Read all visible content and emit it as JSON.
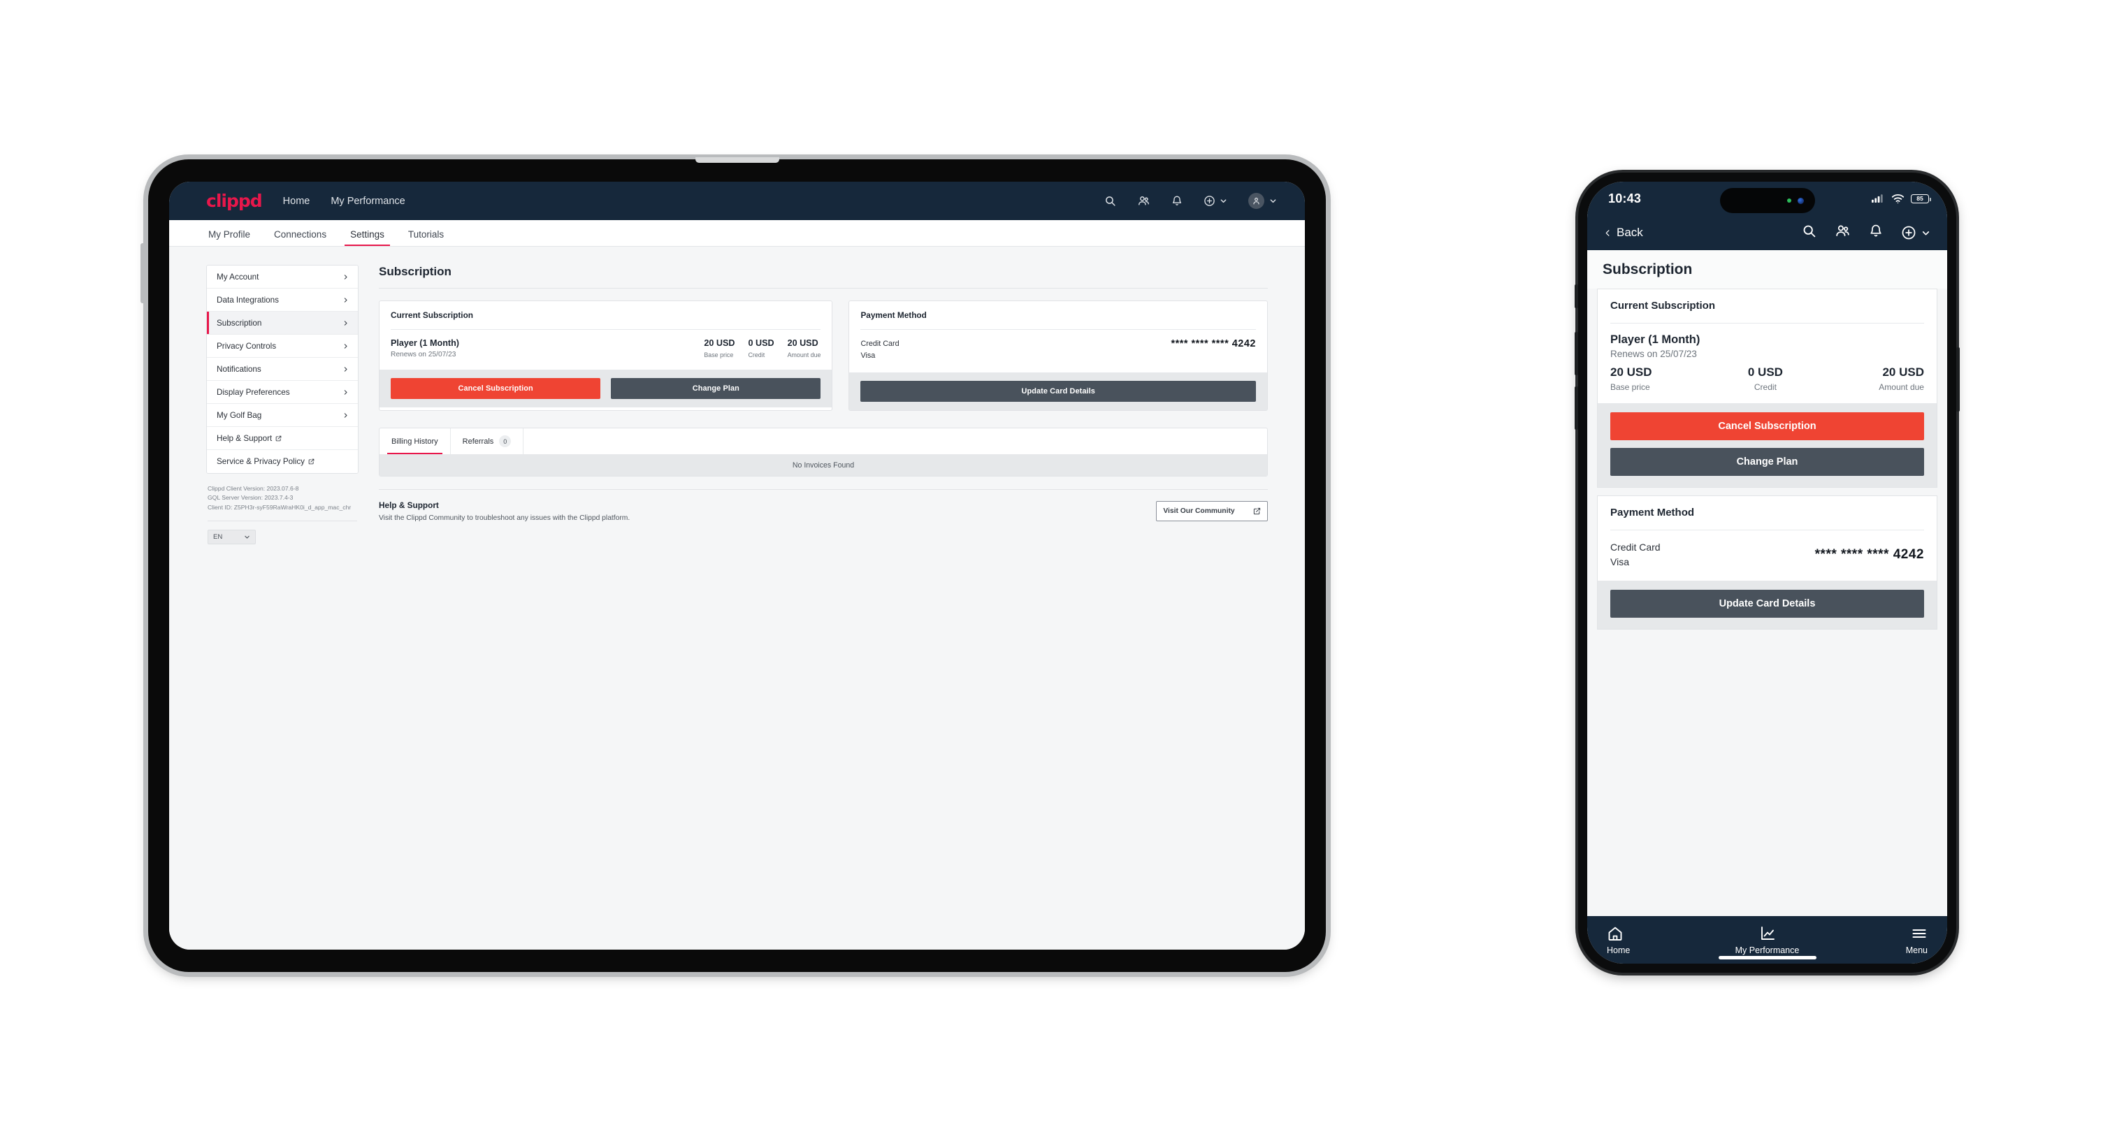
{
  "tablet": {
    "topbar": {
      "logo": "clippd",
      "nav": [
        {
          "label": "Home"
        },
        {
          "label": "My Performance"
        }
      ],
      "icons": [
        {
          "name": "search-icon"
        },
        {
          "name": "people-icon"
        },
        {
          "name": "bell-icon"
        },
        {
          "name": "plus-circle-icon"
        },
        {
          "name": "avatar-icon"
        }
      ]
    },
    "subnav": {
      "tabs": [
        {
          "label": "My Profile",
          "active": false
        },
        {
          "label": "Connections",
          "active": false
        },
        {
          "label": "Settings",
          "active": true
        },
        {
          "label": "Tutorials",
          "active": false
        }
      ]
    },
    "sidebar": {
      "items": [
        {
          "label": "My Account",
          "active": false,
          "external": false
        },
        {
          "label": "Data Integrations",
          "active": false,
          "external": false
        },
        {
          "label": "Subscription",
          "active": true,
          "external": false
        },
        {
          "label": "Privacy Controls",
          "active": false,
          "external": false
        },
        {
          "label": "Notifications",
          "active": false,
          "external": false
        },
        {
          "label": "Display Preferences",
          "active": false,
          "external": false
        },
        {
          "label": "My Golf Bag",
          "active": false,
          "external": false
        },
        {
          "label": "Help & Support",
          "active": false,
          "external": true
        },
        {
          "label": "Service & Privacy Policy",
          "active": false,
          "external": true
        }
      ],
      "version": {
        "client": "Clippd Client Version: 2023.07.6-8",
        "server": "GQL Server Version: 2023.7.4-3",
        "client_id": "Client ID: Z5PH3r-syF59RaWraHK0i_d_app_mac_chr"
      },
      "language": "EN"
    },
    "main": {
      "page_title": "Subscription",
      "subscription_card": {
        "title": "Current Subscription",
        "plan_name": "Player (1 Month)",
        "renews": "Renews on 25/07/23",
        "amounts": [
          {
            "value": "20 USD",
            "label": "Base price"
          },
          {
            "value": "0 USD",
            "label": "Credit"
          },
          {
            "value": "20 USD",
            "label": "Amount due"
          }
        ],
        "cancel_label": "Cancel Subscription",
        "change_label": "Change Plan"
      },
      "payment_card": {
        "title": "Payment Method",
        "type": "Credit Card",
        "brand": "Visa",
        "number": "**** **** **** 4242",
        "update_label": "Update Card Details"
      },
      "history": {
        "tabs": [
          {
            "label": "Billing History",
            "badge": "",
            "active": true
          },
          {
            "label": "Referrals",
            "badge": "0",
            "active": false
          }
        ],
        "empty": "No Invoices Found"
      },
      "help": {
        "title": "Help & Support",
        "subtitle": "Visit the Clippd Community to troubleshoot any issues with the Clippd platform.",
        "button": "Visit Our Community"
      }
    }
  },
  "phone": {
    "status": {
      "time": "10:43",
      "battery": "85"
    },
    "nav": {
      "back": "Back",
      "icons": [
        {
          "name": "search-icon"
        },
        {
          "name": "people-icon"
        },
        {
          "name": "bell-icon"
        },
        {
          "name": "plus-circle-icon"
        }
      ]
    },
    "page_title": "Subscription",
    "subscription_card": {
      "title": "Current Subscription",
      "plan_name": "Player (1 Month)",
      "renews": "Renews on 25/07/23",
      "amounts": [
        {
          "value": "20 USD",
          "label": "Base price"
        },
        {
          "value": "0 USD",
          "label": "Credit"
        },
        {
          "value": "20 USD",
          "label": "Amount due"
        }
      ],
      "cancel_label": "Cancel Subscription",
      "change_label": "Change Plan"
    },
    "payment_card": {
      "title": "Payment Method",
      "type": "Credit Card",
      "brand": "Visa",
      "number": "**** **** **** 4242",
      "update_label": "Update Card Details"
    },
    "tabbar": [
      {
        "label": "Home",
        "icon": "home-icon"
      },
      {
        "label": "My Performance",
        "icon": "chart-icon"
      },
      {
        "label": "Menu",
        "icon": "hamburger-icon"
      }
    ]
  },
  "colors": {
    "header": "#16283b",
    "accent": "#e8174b",
    "danger": "#ef4433",
    "slate": "#49525c"
  }
}
